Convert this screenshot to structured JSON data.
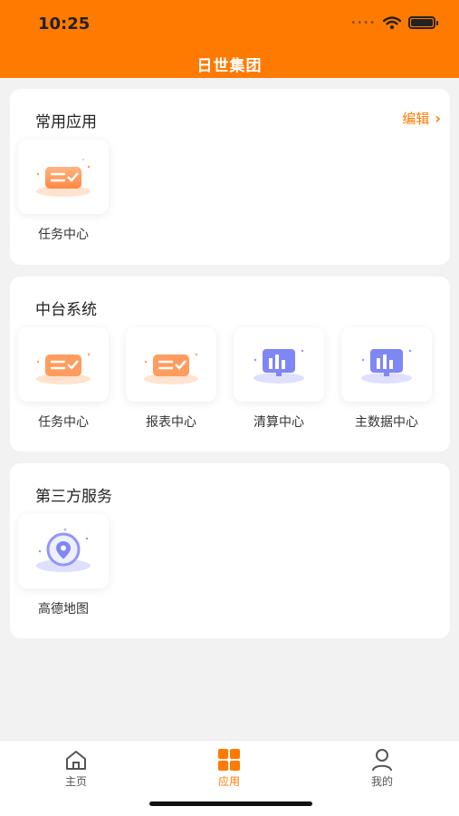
{
  "status_bar": {
    "time": "10:25"
  },
  "header": {
    "title": "日世集团"
  },
  "sections": {
    "common": {
      "title": "常用应用",
      "edit_label": "编辑",
      "apps": [
        {
          "label": "任务中心",
          "icon": "task-card-icon"
        }
      ]
    },
    "platform": {
      "title": "中台系统",
      "apps": [
        {
          "label": "任务中心",
          "icon": "task-card-icon"
        },
        {
          "label": "报表中心",
          "icon": "task-card-icon"
        },
        {
          "label": "清算中心",
          "icon": "monitor-chart-icon"
        },
        {
          "label": "主数据中心",
          "icon": "monitor-chart-icon"
        }
      ]
    },
    "third_party": {
      "title": "第三方服务",
      "apps": [
        {
          "label": "高德地图",
          "icon": "map-pin-icon"
        }
      ]
    }
  },
  "tabbar": {
    "items": [
      {
        "label": "主页",
        "icon": "home-icon"
      },
      {
        "label": "应用",
        "icon": "grid-icon",
        "active": true
      },
      {
        "label": "我的",
        "icon": "user-icon"
      }
    ]
  },
  "colors": {
    "accent": "#ff7a00",
    "background": "#f2f2f2",
    "card": "#ffffff"
  }
}
